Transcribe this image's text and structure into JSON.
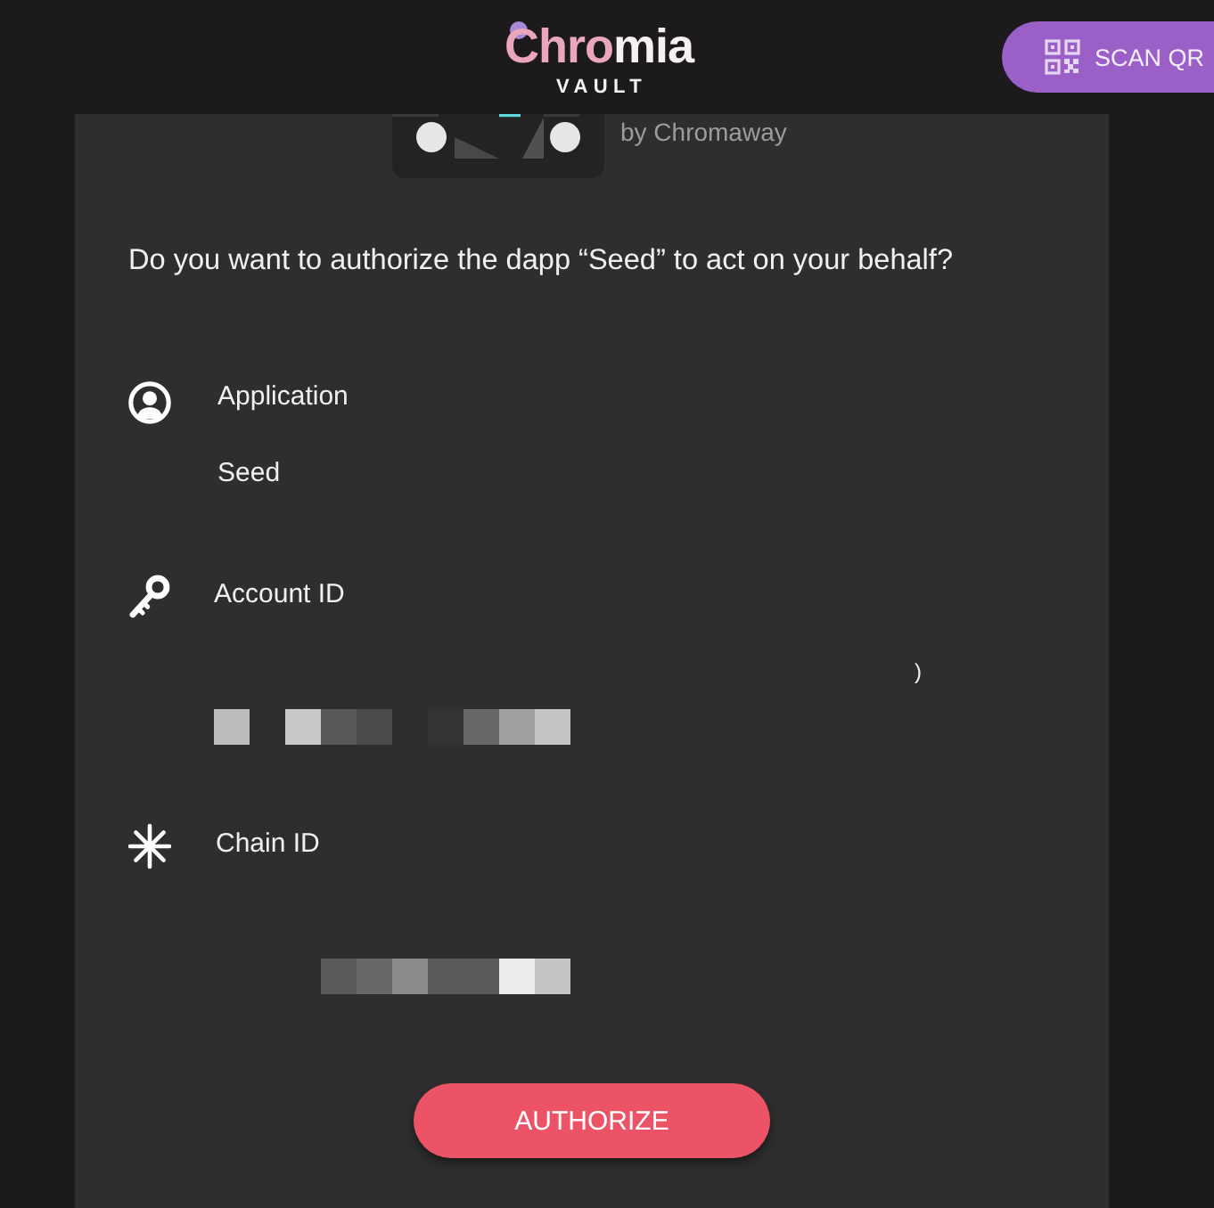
{
  "header": {
    "logo": {
      "parts": [
        "Chro",
        "mia"
      ],
      "subtitle": "VAULT"
    },
    "scan_button": {
      "label": "SCAN QR"
    }
  },
  "dapp": {
    "byline": "by Chromaway"
  },
  "prompt": "Do you want to authorize the dapp “Seed” to act on your behalf?",
  "fields": [
    {
      "kind": "application",
      "label": "Application",
      "value": "Seed"
    },
    {
      "kind": "account",
      "label": "Account ID",
      "fragment": ")",
      "redacted": true
    },
    {
      "kind": "chain",
      "label": "Chain ID",
      "redacted": true
    }
  ],
  "authorize_button": {
    "label": "AUTHORIZE"
  }
}
